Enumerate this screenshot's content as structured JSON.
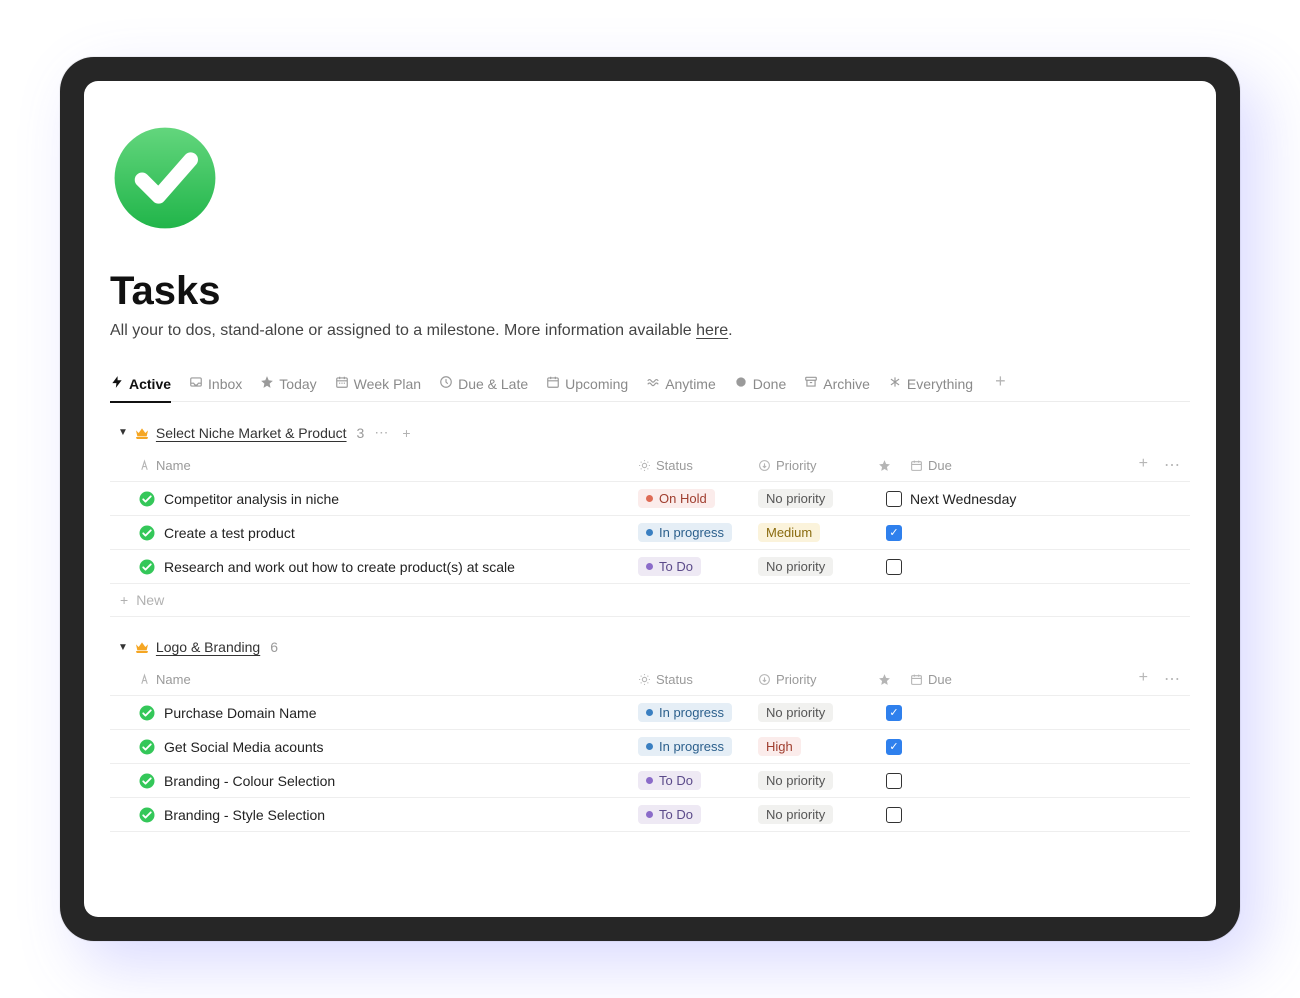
{
  "page": {
    "title": "Tasks",
    "subtitle_pre": "All your to dos, stand-alone or assigned to a milestone. More information available ",
    "subtitle_link": "here",
    "subtitle_post": "."
  },
  "tabs": [
    {
      "label": "Active",
      "icon": "bolt-icon",
      "active": true
    },
    {
      "label": "Inbox",
      "icon": "inbox-icon"
    },
    {
      "label": "Today",
      "icon": "star-icon"
    },
    {
      "label": "Week Plan",
      "icon": "calendar-week-icon"
    },
    {
      "label": "Due & Late",
      "icon": "clock-icon"
    },
    {
      "label": "Upcoming",
      "icon": "calendar-icon"
    },
    {
      "label": "Anytime",
      "icon": "wave-icon"
    },
    {
      "label": "Done",
      "icon": "filled-circle-icon"
    },
    {
      "label": "Archive",
      "icon": "archive-icon"
    },
    {
      "label": "Everything",
      "icon": "asterisk-icon"
    }
  ],
  "columns": {
    "name": "Name",
    "status": "Status",
    "priority": "Priority",
    "due": "Due"
  },
  "newRowLabel": "New",
  "groups": [
    {
      "name": "Select Niche Market & Product",
      "count": 3,
      "rows": [
        {
          "name": "Competitor analysis in niche",
          "status": "On Hold",
          "statusKey": "onhold",
          "priority": "No priority",
          "priorityKey": "nopriority",
          "starred": false,
          "due": "Next Wednesday"
        },
        {
          "name": "Create a test product",
          "status": "In progress",
          "statusKey": "inprogress",
          "priority": "Medium",
          "priorityKey": "medium",
          "starred": true,
          "due": ""
        },
        {
          "name": "Research and work out how to create product(s) at scale",
          "status": "To Do",
          "statusKey": "todo",
          "priority": "No priority",
          "priorityKey": "nopriority",
          "starred": false,
          "due": ""
        }
      ]
    },
    {
      "name": "Logo & Branding",
      "count": 6,
      "rows": [
        {
          "name": "Purchase Domain Name",
          "status": "In progress",
          "statusKey": "inprogress",
          "priority": "No priority",
          "priorityKey": "nopriority",
          "starred": true,
          "due": ""
        },
        {
          "name": "Get Social Media acounts",
          "status": "In progress",
          "statusKey": "inprogress",
          "priority": "High",
          "priorityKey": "high",
          "starred": true,
          "due": ""
        },
        {
          "name": "Branding - Colour Selection",
          "status": "To Do",
          "statusKey": "todo",
          "priority": "No priority",
          "priorityKey": "nopriority",
          "starred": false,
          "due": ""
        },
        {
          "name": "Branding - Style Selection",
          "status": "To Do",
          "statusKey": "todo",
          "priority": "No priority",
          "priorityKey": "nopriority",
          "starred": false,
          "due": ""
        }
      ]
    }
  ]
}
